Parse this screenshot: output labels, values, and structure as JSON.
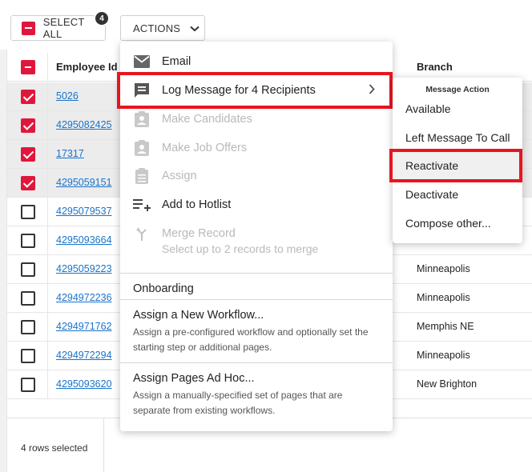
{
  "toolbar": {
    "select_all_label": "SELECT ALL",
    "selected_count": "4",
    "actions_label": "ACTIONS"
  },
  "table": {
    "headers": {
      "employee_id": "Employee Id",
      "branch": "Branch"
    },
    "rows": [
      {
        "id": "5026",
        "branch": "",
        "checked": true
      },
      {
        "id": "4295082425",
        "branch": "",
        "checked": true
      },
      {
        "id": "17317",
        "branch": "",
        "checked": true
      },
      {
        "id": "4295059151",
        "branch": "",
        "checked": true
      },
      {
        "id": "4295079537",
        "branch": "",
        "checked": false
      },
      {
        "id": "4295093664",
        "branch": "",
        "checked": false
      },
      {
        "id": "4295059223",
        "branch": "Minneapolis",
        "checked": false
      },
      {
        "id": "4294972236",
        "branch": "Minneapolis",
        "checked": false
      },
      {
        "id": "4294971762",
        "branch": "Memphis NE",
        "checked": false
      },
      {
        "id": "4294972294",
        "branch": "Minneapolis",
        "checked": false
      },
      {
        "id": "4295093620",
        "branch": "New Brighton",
        "checked": false
      }
    ],
    "footer": "4 rows selected"
  },
  "actions_menu": {
    "email": "Email",
    "log_message": "Log Message for 4 Recipients",
    "make_candidates": "Make Candidates",
    "make_job_offers": "Make Job Offers",
    "assign": "Assign",
    "add_to_hotlist": "Add to Hotlist",
    "merge_record": "Merge Record",
    "merge_record_hint": "Select up to 2 records to merge",
    "onboarding": {
      "title": "Onboarding",
      "workflow_title": "Assign a New Workflow...",
      "workflow_desc": "Assign a pre-configured workflow and optionally set the starting step or additional pages.",
      "adhoc_title": "Assign Pages Ad Hoc...",
      "adhoc_desc": "Assign a manually-specified set of pages that are separate from existing workflows."
    }
  },
  "submenu": {
    "header": "Message Action",
    "items": [
      "Available",
      "Left Message To Call",
      "Reactivate",
      "Deactivate",
      "Compose other..."
    ]
  },
  "colors": {
    "accent_red": "#e0173c",
    "highlight": "#e8151f",
    "link": "#1a73c9"
  }
}
